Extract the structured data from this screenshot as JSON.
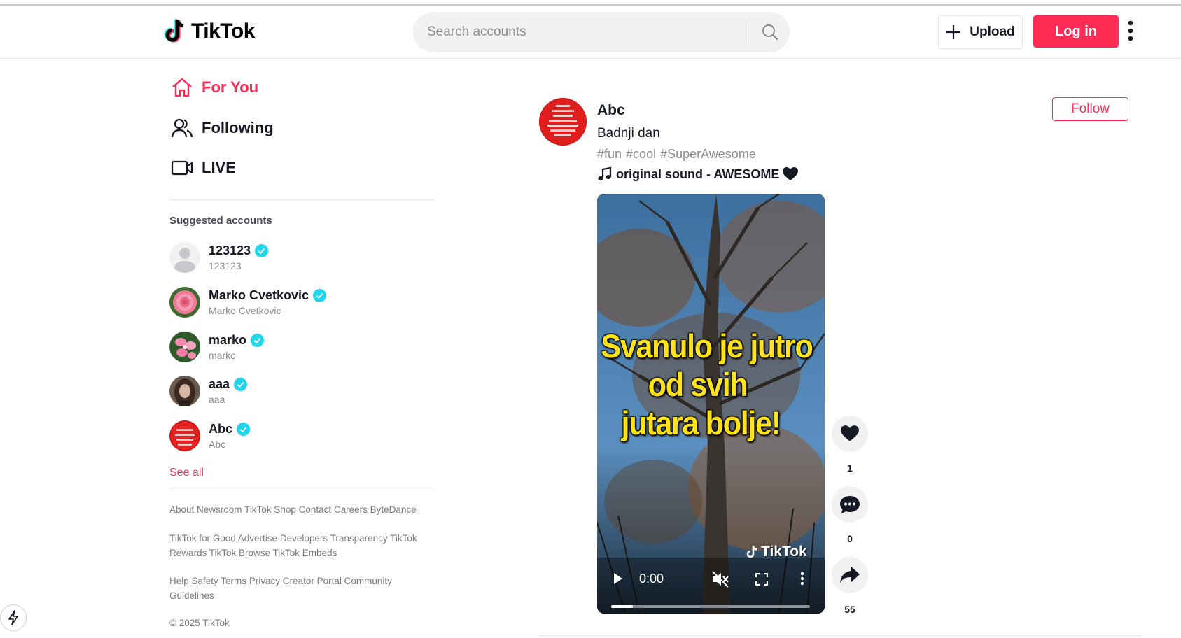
{
  "header": {
    "logo_text": "TikTok",
    "search_placeholder": "Search accounts",
    "upload_label": "Upload",
    "login_label": "Log in"
  },
  "nav": [
    {
      "label": "For You",
      "icon": "home-icon",
      "active": true
    },
    {
      "label": "Following",
      "icon": "users-icon",
      "active": false
    },
    {
      "label": "LIVE",
      "icon": "live-video-icon",
      "active": false
    }
  ],
  "suggested": {
    "title": "Suggested accounts",
    "accounts": [
      {
        "name": "123123",
        "handle": "123123",
        "verified": true
      },
      {
        "name": "Marko Cvetkovic",
        "handle": "Marko Cvetkovic",
        "verified": true
      },
      {
        "name": "marko",
        "handle": "marko",
        "verified": true
      },
      {
        "name": "aaa",
        "handle": "aaa",
        "verified": true
      },
      {
        "name": "Abc",
        "handle": "Abc",
        "verified": true
      }
    ],
    "see_all": "See all"
  },
  "footer": {
    "line1": "About Newsroom TikTok Shop Contact Careers ByteDance",
    "line2": "TikTok for Good Advertise Developers Transparency TikTok Rewards TikTok Browse TikTok Embeds",
    "line3": "Help Safety Terms Privacy Creator Portal Community Guidelines",
    "copyright": "© 2025 TikTok"
  },
  "post": {
    "author": "Abc",
    "caption": "Badnji dan",
    "hashtags": [
      "#fun",
      "#cool",
      "#SuperAwesome"
    ],
    "sound": "original sound - AWESOME",
    "follow_label": "Follow",
    "video": {
      "overlay_line1": "Svanulo je jutro",
      "overlay_line2": "od svih",
      "overlay_line3": "jutara bolje!",
      "watermark": "TikTok",
      "time": "0:00",
      "progress": 0.11
    },
    "likes": "1",
    "comments": "0",
    "shares": "55"
  },
  "colors": {
    "brand": "#fe2c55",
    "verified": "#20d5ec"
  }
}
